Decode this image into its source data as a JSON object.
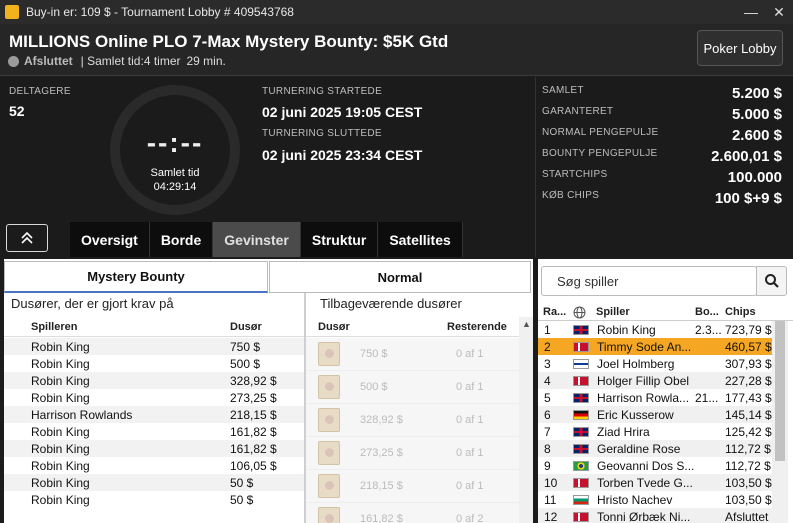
{
  "window": {
    "title": "Buy-in er: 109 $ - Tournament Lobby # 409543768",
    "minimize": "—",
    "close": "✕"
  },
  "header": {
    "tournament_name": "MILLIONS Online PLO 7-Max Mystery Bounty: $5K Gtd",
    "status": "Afsluttet",
    "total_time_label": "| Samlet tid:4 timer",
    "total_time_min": "29 min.",
    "lobby_button": "Poker Lobby"
  },
  "info": {
    "participants_label": "DELTAGERE",
    "participants_value": "52",
    "clock_digits": "--:--",
    "clock_label": "Samlet tid",
    "clock_value": "04:29:14",
    "started_label": "TURNERING STARTEDE",
    "started_value": "02 juni 2025  19:05 CEST",
    "ended_label": "TURNERING SLUTTEDE",
    "ended_value": "02 juni 2025  23:34 CEST"
  },
  "prize_info": [
    {
      "label": "SAMLET",
      "value": "5.200 $"
    },
    {
      "label": "GARANTERET",
      "value": "5.000 $"
    },
    {
      "label": "NORMAL PENGEPULJE",
      "value": "2.600 $"
    },
    {
      "label": "BOUNTY PENGEPULJE",
      "value": "2.600,01 $"
    },
    {
      "label": "STARTCHIPS",
      "value": "100.000"
    },
    {
      "label": "KØB CHIPS",
      "value": "100 $+9 $"
    }
  ],
  "tabs": [
    "Oversigt",
    "Borde",
    "Gevinster",
    "Struktur",
    "Satellites"
  ],
  "active_tab": "Gevinster",
  "subtabs": [
    "Mystery Bounty",
    "Normal"
  ],
  "claimed": {
    "title": "Dusører, der er gjort krav på",
    "col_player": "Spilleren",
    "col_bounty": "Dusør",
    "rows": [
      [
        "Robin King",
        "750 $"
      ],
      [
        "Robin King",
        "500 $"
      ],
      [
        "Robin King",
        "328,92 $"
      ],
      [
        "Robin King",
        "273,25 $"
      ],
      [
        "Harrison Rowlands",
        "218,15 $"
      ],
      [
        "Robin King",
        "161,82 $"
      ],
      [
        "Robin King",
        "161,82 $"
      ],
      [
        "Robin King",
        "106,05 $"
      ],
      [
        "Robin King",
        "50 $"
      ],
      [
        "Robin King",
        "50 $"
      ]
    ]
  },
  "remaining": {
    "title": "Tilbageværende dusører",
    "col_bounty": "Dusør",
    "col_remaining": "Resterende",
    "rows": [
      [
        "750 $",
        "0 af 1"
      ],
      [
        "500 $",
        "0 af 1"
      ],
      [
        "328,92 $",
        "0 af 1"
      ],
      [
        "273,25 $",
        "0 af 1"
      ],
      [
        "218,15 $",
        "0 af 1"
      ],
      [
        "161,82 $",
        "0 af 2"
      ]
    ]
  },
  "players": {
    "search_placeholder": "Søg spiller",
    "col_rank": "Ra...",
    "col_player": "Spiller",
    "col_bounty": "Bo...",
    "col_chips": "Chips",
    "rows": [
      {
        "rank": "1",
        "flag": "gb",
        "name": "Robin King",
        "bounty": "2.3...",
        "chips": "723,79 $"
      },
      {
        "rank": "2",
        "flag": "dk",
        "name": "Timmy Sode An...",
        "bounty": "",
        "chips": "460,57 $"
      },
      {
        "rank": "3",
        "flag": "fi",
        "name": "Joel Holmberg",
        "bounty": "",
        "chips": "307,93 $"
      },
      {
        "rank": "4",
        "flag": "dk",
        "name": "Holger Fillip Obel",
        "bounty": "",
        "chips": "227,28 $"
      },
      {
        "rank": "5",
        "flag": "gb",
        "name": "Harrison Rowla...",
        "bounty": "21...",
        "chips": "177,43 $"
      },
      {
        "rank": "6",
        "flag": "de",
        "name": "Eric Kusserow",
        "bounty": "",
        "chips": "145,14 $"
      },
      {
        "rank": "7",
        "flag": "gb",
        "name": "Ziad Hrira",
        "bounty": "",
        "chips": "125,42 $"
      },
      {
        "rank": "8",
        "flag": "gb",
        "name": "Geraldine Rose",
        "bounty": "",
        "chips": "112,72 $"
      },
      {
        "rank": "9",
        "flag": "br",
        "name": "Geovanni Dos S...",
        "bounty": "",
        "chips": "112,72 $"
      },
      {
        "rank": "10",
        "flag": "dk",
        "name": "Torben Tvede G...",
        "bounty": "",
        "chips": "103,50 $"
      },
      {
        "rank": "11",
        "flag": "bg",
        "name": "Hristo Nachev",
        "bounty": "",
        "chips": "103,50 $"
      },
      {
        "rank": "12",
        "flag": "dk",
        "name": "Tonni Ørbæk Ni...",
        "bounty": "",
        "chips": "Afsluttet"
      }
    ],
    "selected_rank": "2"
  }
}
